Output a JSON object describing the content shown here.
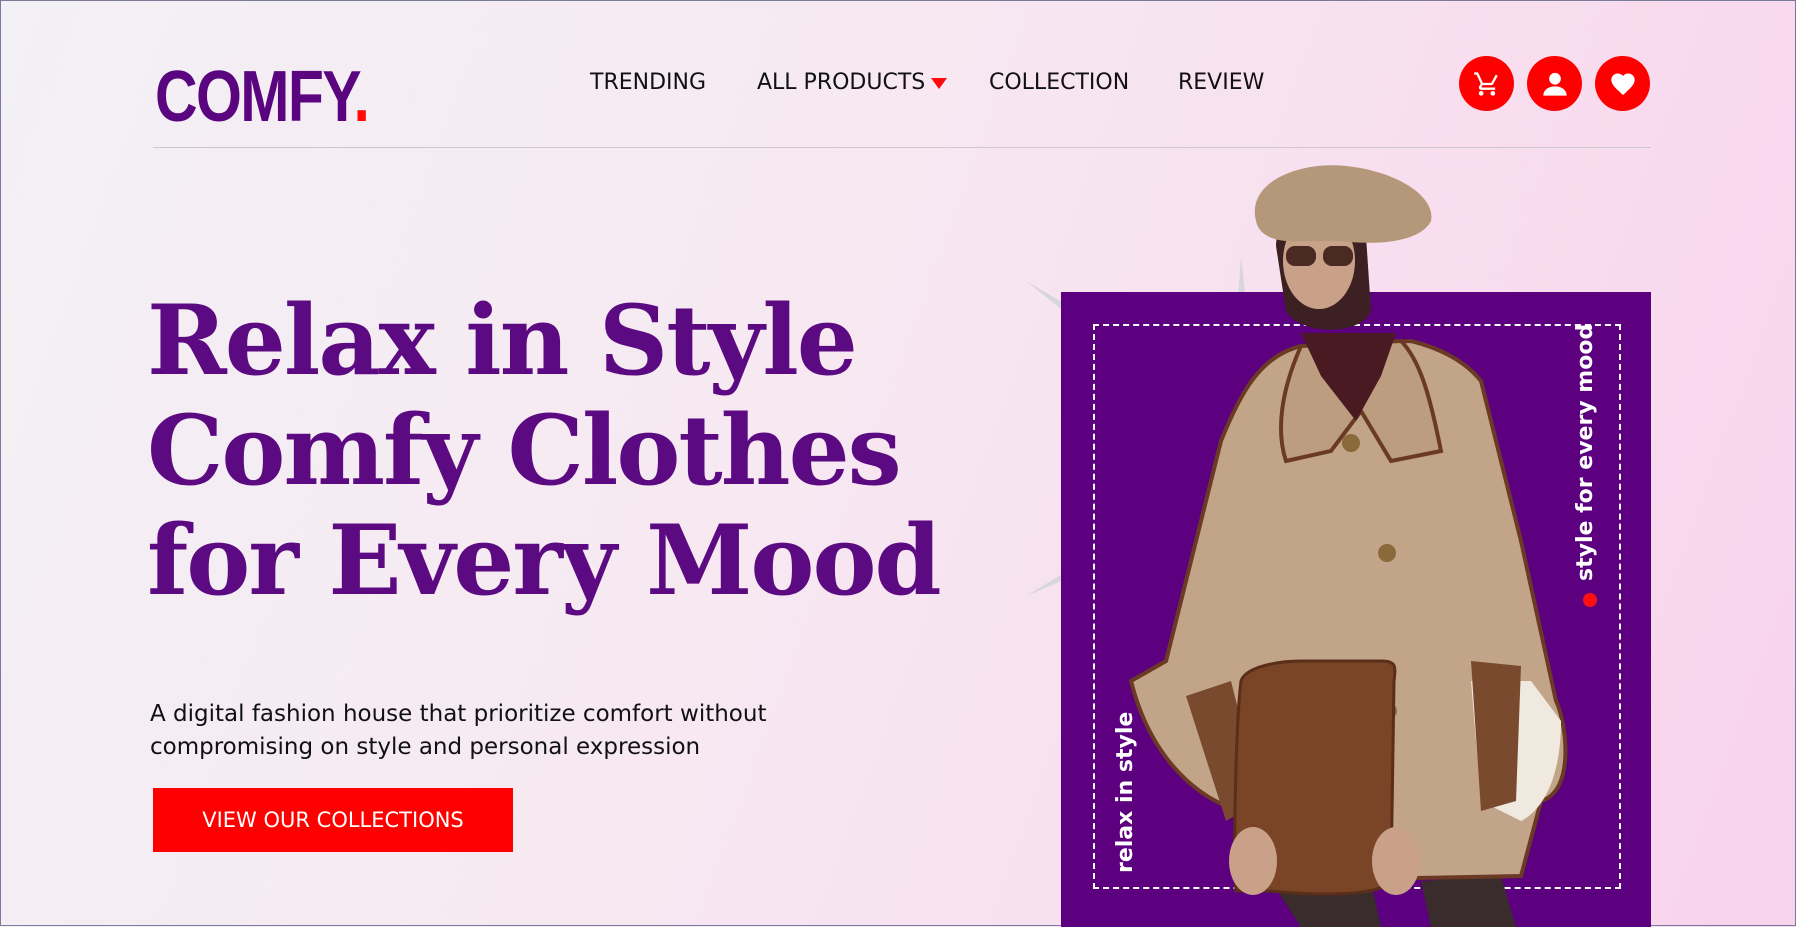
{
  "brand": {
    "name": "COMFY",
    "dot": "."
  },
  "nav": {
    "items": [
      {
        "label": "TRENDING"
      },
      {
        "label": "ALL PRODUCTS",
        "has_dropdown": true
      },
      {
        "label": "COLLECTION"
      },
      {
        "label": "REVIEW"
      }
    ]
  },
  "actions": {
    "icons": [
      "cart-icon",
      "user-icon",
      "heart-icon"
    ],
    "accent": "#ff0000"
  },
  "hero": {
    "headline_lines": [
      "Relax in Style",
      "Comfy Clothes",
      "for Every Mood"
    ],
    "subtext": "A digital fashion house that prioritize comfort without compromising on style and personal expression",
    "cta_label": "VIEW OUR COLLECTIONS",
    "tag_right": "style for every mood",
    "tag_left": "relax in style",
    "colors": {
      "primary": "#5c0a82",
      "panel": "#5c0080",
      "accent": "#ff0000"
    }
  }
}
